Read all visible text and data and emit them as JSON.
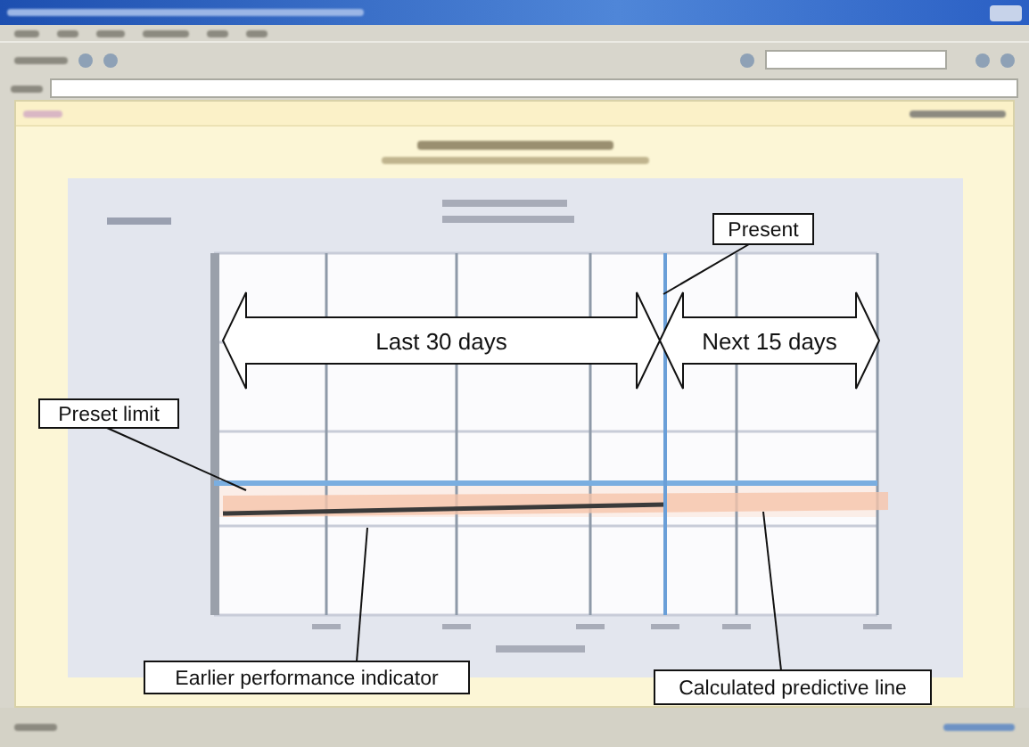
{
  "period_arrows": [
    {
      "label": "Last 30 days"
    },
    {
      "label": "Next 15 days"
    }
  ],
  "callouts": [
    {
      "label": "Present"
    },
    {
      "label": "Preset limit"
    },
    {
      "label": "Earlier performance indicator"
    },
    {
      "label": "Calculated predictive line"
    }
  ]
}
